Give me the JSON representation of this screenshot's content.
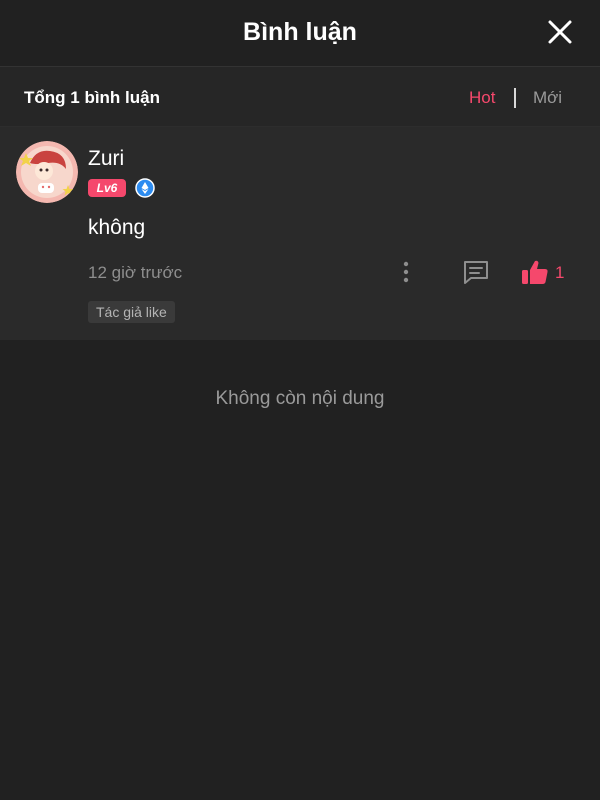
{
  "header": {
    "title": "Bình luận",
    "close_icon": "close-icon"
  },
  "subbar": {
    "total_text": "Tổng 1 bình luận",
    "sort_hot": "Hot",
    "sort_new": "Mới",
    "active_sort": "Hot",
    "accent_color": "#f5486c"
  },
  "comments": [
    {
      "username": "Zuri",
      "level_badge": "Lv6",
      "verified_icon": "verified-badge-icon",
      "content": "không",
      "timestamp": "12 giờ trước",
      "likes": "1",
      "liked": true,
      "author_like_tag": "Tác giả like",
      "icons": [
        "more-icon",
        "reply-icon",
        "thumbs-up-icon"
      ]
    }
  ],
  "empty_text": "Không còn nội dung"
}
